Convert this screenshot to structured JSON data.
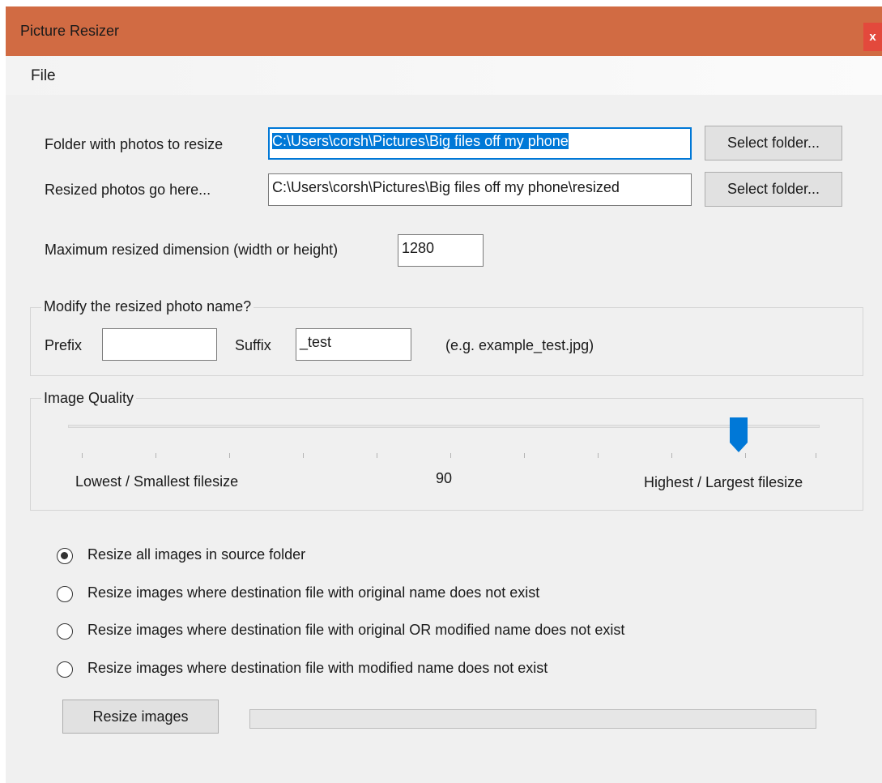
{
  "window": {
    "title": "Picture Resizer",
    "close_label": "x"
  },
  "menu": {
    "file": "File"
  },
  "folders": {
    "source_label": "Folder with photos to resize",
    "source_value": "C:\\Users\\corsh\\Pictures\\Big files off my phone",
    "dest_label": "Resized photos go here...",
    "dest_value": "C:\\Users\\corsh\\Pictures\\Big files off my phone\\resized",
    "select_button": "Select folder...",
    "select_button_2": "Select folder..."
  },
  "max_dimension": {
    "label": "Maximum resized dimension (width or height)",
    "value": "1280"
  },
  "name_group": {
    "legend": "Modify the resized photo name?",
    "prefix_label": "Prefix",
    "prefix_value": "",
    "suffix_label": "Suffix",
    "suffix_value": "_test",
    "example": "(e.g. example_test.jpg)"
  },
  "quality_group": {
    "legend": "Image Quality",
    "low_label": "Lowest / Smallest filesize",
    "value_label": "90",
    "high_label": "Highest / Largest filesize",
    "slider_value": 90,
    "slider_min": 0,
    "slider_max": 100
  },
  "resize_options": [
    {
      "label": "Resize all images in source folder",
      "checked": true
    },
    {
      "label": "Resize images where destination file with original name does not exist",
      "checked": false
    },
    {
      "label": "Resize images where destination file with original OR modified name does not exist",
      "checked": false
    },
    {
      "label": "Resize images where destination file with modified name does not exist",
      "checked": false
    }
  ],
  "actions": {
    "resize_button": "Resize images",
    "progress": 0
  },
  "colors": {
    "titlebar": "#d16b43",
    "accent": "#0078d7",
    "close": "#e3493c"
  }
}
